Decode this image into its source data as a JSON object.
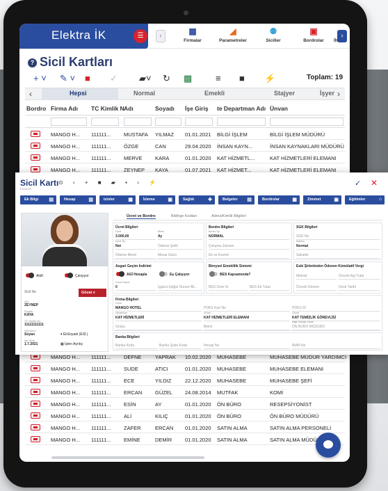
{
  "app": {
    "brand": "Elektra İK"
  },
  "modules": [
    {
      "label": "Firmalar",
      "icon": "building-icon",
      "color": "#2a4d9f"
    },
    {
      "label": "Parametreler",
      "icon": "triangle-icon",
      "color": "#e86a1a"
    },
    {
      "label": "Siciller",
      "icon": "users-icon",
      "color": "#39a2d8"
    },
    {
      "label": "Bordrolar",
      "icon": "calculator-icon",
      "color": "#d6232d"
    },
    {
      "label": "İhb",
      "icon": "doc-icon",
      "color": "#333333"
    }
  ],
  "page": {
    "title": "Sicil Kartları",
    "total": "Toplam: 19"
  },
  "tabs": [
    "Hepsi",
    "Normal",
    "Emekli",
    "Stajyer",
    "İşyer"
  ],
  "columns": [
    "Bordro",
    "Firma Adı",
    "TC Kimlik N",
    "Adı",
    "Soyadı",
    "İşe Giriş",
    "te Departman Adı",
    "Ünvan"
  ],
  "rows_top": [
    [
      "MANGO H...",
      "111111...",
      "MUSTAFA",
      "YILMAZ",
      "01.01.2021",
      "BİLGİ İŞLEM",
      "BİLGİ İŞLEM MÜDÜRÜ"
    ],
    [
      "MANGO H...",
      "111111...",
      "ÖZGE",
      "CAN",
      "29.04.2020",
      "İNSAN KAYN...",
      "İNSAN KAYNAKLARI MÜDÜRÜ"
    ],
    [
      "MANGO H...",
      "111111...",
      "MERVE",
      "KARA",
      "01.01.2020",
      "KAT HİZMETL...",
      "KAT HİZMETLERİ ELEMANI"
    ],
    [
      "MANGO H...",
      "111111...",
      "ZEYNEP",
      "KAYA",
      "01.07.2021",
      "KAT HİZMET...",
      "KAT HİZMETLERİ ELEMANI"
    ]
  ],
  "rows_bottom": [
    [
      "MANGO H...",
      "111111...",
      "DEFNE",
      "YAPRAK",
      "10.02.2020",
      "MUHASEBE",
      "MUHASEBE MÜDÜR YARDIMCI"
    ],
    [
      "MANGO H...",
      "111111...",
      "SUDE",
      "ATICI",
      "01.01.2020",
      "MUHASEBE",
      "MUHASEBE ELEMANI"
    ],
    [
      "MANGO H...",
      "111111...",
      "ECE",
      "YILDIZ",
      "22.12.2020",
      "MUHASEBE",
      "MUHASEBE ŞEFİ"
    ],
    [
      "MANGO H...",
      "111111...",
      "ERCAN",
      "GÜZEL",
      "24.08.2014",
      "MUTFAK",
      "KOMİ"
    ],
    [
      "MANGO H...",
      "111111...",
      "ESİN",
      "AY",
      "01.01.2020",
      "ÖN BÜRO",
      "RESEPSİYONİST"
    ],
    [
      "MANGO H...",
      "111111...",
      "ALİ",
      "KILIÇ",
      "01.01.2020",
      "ÖN BÜRO",
      "ÖN BÜRO MÜDÜRÜ"
    ],
    [
      "MANGO H...",
      "111111...",
      "ZAFER",
      "ERCAN",
      "01.01.2020",
      "SATIN ALMA",
      "SATIN ALMA PERSONELİ"
    ],
    [
      "MANGO H...",
      "111111...",
      "EMİNE",
      "DEMİR",
      "01.01.2020",
      "SATIN ALMA",
      "SATIN ALMA MÜDÜRÜ"
    ]
  ],
  "modal": {
    "title": "Sicil Kartı",
    "sub": "FXXXXX",
    "buttons": [
      "Ek Bilgi",
      "Hesap",
      "izinler",
      "İzleme",
      "Sağlık",
      "Belgeler",
      "Bordrolar",
      "Zimmet",
      "Eğitimler"
    ],
    "left": {
      "aktif": "Aktif",
      "calisiyor": "Çalışıyor",
      "sicil_no": "Sicil No",
      "gorsel": "Gözat",
      "adi_label": "Adı",
      "adi": "ZEYNEP",
      "soyadi_label": "Soyadı",
      "soyadi": "KAYA",
      "tc_label": "TC Kimlik No",
      "tc": "11111111111",
      "gorunum_label": "Görünüm",
      "gorunum": "Soyan",
      "ek_soyadi": "EkSoyadı (ESİ.)",
      "ise_giris_label": "İşe Giriş",
      "ise_giris": "1.7.2021",
      "isten_ayrilis": "İşten Ayrılış"
    },
    "form_tabs": [
      "Ücret ve Bordro",
      "Bildirge Kodları",
      "Adres/Kimlik Bilgileri"
    ],
    "ucret": {
      "title": "Ücret Bilgileri",
      "ucret_l": "Ücret",
      "ucret": "3.000,00",
      "birim_l": "Birimi",
      "birim": "Ay",
      "tip_l": "Ücret Tip",
      "tip": "Net",
      "odeme": "Ödeme Şekli",
      "odeme_birimi": "Ödeme Birimi",
      "mesai": "Mesai Günü"
    },
    "bordro": {
      "title": "Bordro Bilgileri",
      "tip_l": "Bordro Tip",
      "tip": "NORMAL",
      "calisma": "Çalışma Zamanı",
      "ek": "Ek ve Kesinti"
    },
    "sgk": {
      "title": "SGK Bilgileri",
      "no": "SGK No",
      "statu_l": "Statüsü",
      "statu": "Normal",
      "sakatlik": "Sakatlık"
    },
    "asgari": {
      "title": "Asgari Geçim İndirimi",
      "agi": "AGİ Hesapla",
      "es": "Eş Çalışıyor",
      "cocuk_l": "Çocuk Sayısı",
      "cocuk": "0",
      "isgucu": "İşgücü İştiğal Durum Bil..."
    },
    "bes": {
      "title": "Bireysel Emeklilik Sistemi",
      "kapsam": "BES Kapsamında?",
      "oran": "BES Oran %",
      "tutar": "BES Ek Tutar"
    },
    "vergi": {
      "title": "Eski Şirketinden Ödenen Kümülatif Vergi",
      "matrah": "Matrah",
      "onceki": "Önceki Agi Tutar",
      "onceki_donem": "Önceki Dönem",
      "devir": "Devir Tarihi"
    },
    "firma": {
      "title": "Firma Bilgileri",
      "firma_l": "Firma",
      "firma": "MANGO HOTEL",
      "pdks": "PDKS Kart No",
      "pdks_id": "PDKS ID",
      "dept_l": "Departman",
      "dept": "KAT HİZMETLERİ",
      "unvan_l": "Ünvan",
      "unvan": "KAT HİZMETLERİ ELEMANI",
      "gorev_l": "Görevi",
      "gorev": "KAT TEMİZLİK GÖREVLİSİ",
      "grubu": "Grubu",
      "birim": "Birimi",
      "bagli_l": "Bağlı Olduğu Ünvan",
      "bagli": "ÖN BÜRO MÜDÜRÜ"
    },
    "banka": {
      "title": "Banka Bilgileri",
      "kodu": "Banka Kodu",
      "sube": "Banka Şube Kodu",
      "hesap": "Hesap No",
      "iban": "IBAN No"
    }
  }
}
